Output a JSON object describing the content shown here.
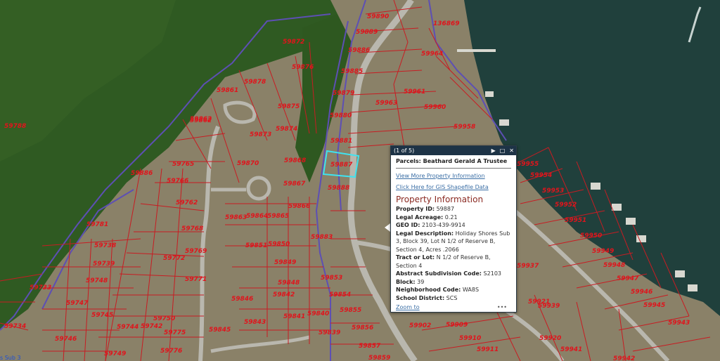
{
  "parcels": [
    {
      "id": "59890"
    },
    {
      "id": "136869"
    },
    {
      "id": "59889"
    },
    {
      "id": "59872"
    },
    {
      "id": "59886"
    },
    {
      "id": "59964"
    },
    {
      "id": "59876"
    },
    {
      "id": "59885"
    },
    {
      "id": "59878"
    },
    {
      "id": "59861"
    },
    {
      "id": "59961"
    },
    {
      "id": "59879"
    },
    {
      "id": "59963"
    },
    {
      "id": "59875"
    },
    {
      "id": "59960"
    },
    {
      "id": "59880"
    },
    {
      "id": "59862"
    },
    {
      "id": "59874"
    },
    {
      "id": "59958"
    },
    {
      "id": "59881"
    },
    {
      "id": "59873"
    },
    {
      "id": "59868"
    },
    {
      "id": "59870"
    },
    {
      "id": "59887"
    },
    {
      "id": "59765"
    },
    {
      "id": "59867"
    },
    {
      "id": "59888"
    },
    {
      "id": "59766"
    },
    {
      "id": "59955"
    },
    {
      "id": "59954"
    },
    {
      "id": "59953"
    },
    {
      "id": "59762"
    },
    {
      "id": "59866"
    },
    {
      "id": "59952"
    },
    {
      "id": "59863"
    },
    {
      "id": "59864"
    },
    {
      "id": "59865"
    },
    {
      "id": "59951"
    },
    {
      "id": "59768"
    },
    {
      "id": "59883"
    },
    {
      "id": "59950"
    },
    {
      "id": "59851"
    },
    {
      "id": "59850"
    },
    {
      "id": "59769"
    },
    {
      "id": "59949"
    },
    {
      "id": "59772"
    },
    {
      "id": "59849"
    },
    {
      "id": "59948"
    },
    {
      "id": "59937"
    },
    {
      "id": "59853"
    },
    {
      "id": "59947"
    },
    {
      "id": "59771"
    },
    {
      "id": "59848"
    },
    {
      "id": "59946"
    },
    {
      "id": "59842"
    },
    {
      "id": "59854"
    },
    {
      "id": "59846"
    },
    {
      "id": "59921"
    },
    {
      "id": "59945"
    },
    {
      "id": "59855"
    },
    {
      "id": "59939"
    },
    {
      "id": "59840"
    },
    {
      "id": "59843"
    },
    {
      "id": "59841"
    },
    {
      "id": "59943"
    },
    {
      "id": "59902"
    },
    {
      "id": "59909"
    },
    {
      "id": "59845"
    },
    {
      "id": "59839"
    },
    {
      "id": "59856"
    },
    {
      "id": "59910"
    },
    {
      "id": "59920"
    },
    {
      "id": "59857"
    },
    {
      "id": "59911"
    },
    {
      "id": "59941"
    },
    {
      "id": "59775"
    },
    {
      "id": "59776"
    },
    {
      "id": "59942"
    },
    {
      "id": "59859"
    },
    {
      "id": "59734"
    },
    {
      "id": "59746"
    },
    {
      "id": "59745"
    },
    {
      "id": "59744"
    },
    {
      "id": "59742"
    },
    {
      "id": "59747"
    },
    {
      "id": "59748"
    },
    {
      "id": "59739"
    },
    {
      "id": "59749"
    },
    {
      "id": "59733"
    },
    {
      "id": "59788"
    },
    {
      "id": "59781"
    },
    {
      "id": "59738"
    },
    {
      "id": "59886"
    },
    {
      "id": "59750"
    },
    {
      "id": "59862"
    }
  ],
  "sublabel": "s Sub 3",
  "popup": {
    "counter": "(1 of 5)",
    "next_glyph": "▶",
    "maximize_glyph": "□",
    "close_glyph": "✕",
    "parcel_title": "Parcels: Beathard Gerald A Trustee",
    "link_more": "View More Property Information",
    "link_gis": "Click Here for GIS Shapefile Data",
    "section_title": "Property Information",
    "fields": [
      {
        "label": "Property ID:",
        "value": "59887"
      },
      {
        "label": "Legal Acreage:",
        "value": "0.21"
      },
      {
        "label": "GEO ID:",
        "value": "2103-439-9914"
      },
      {
        "label": "Legal Description:",
        "value": "Holiday Shores Sub 3, Block 39, Lot N 1/2 of Reserve B, Section 4, Acres .2066"
      },
      {
        "label": "Tract or Lot:",
        "value": "N 1/2 of Reserve B, Section 4"
      },
      {
        "label": "Abstract Subdivision Code:",
        "value": "S2103"
      },
      {
        "label": "Block:",
        "value": "39"
      },
      {
        "label": "Neighborhood Code:",
        "value": "WA8S"
      },
      {
        "label": "School District:",
        "value": "SCS"
      }
    ],
    "zoom_link": "Zoom to",
    "more_glyph": "•••"
  }
}
